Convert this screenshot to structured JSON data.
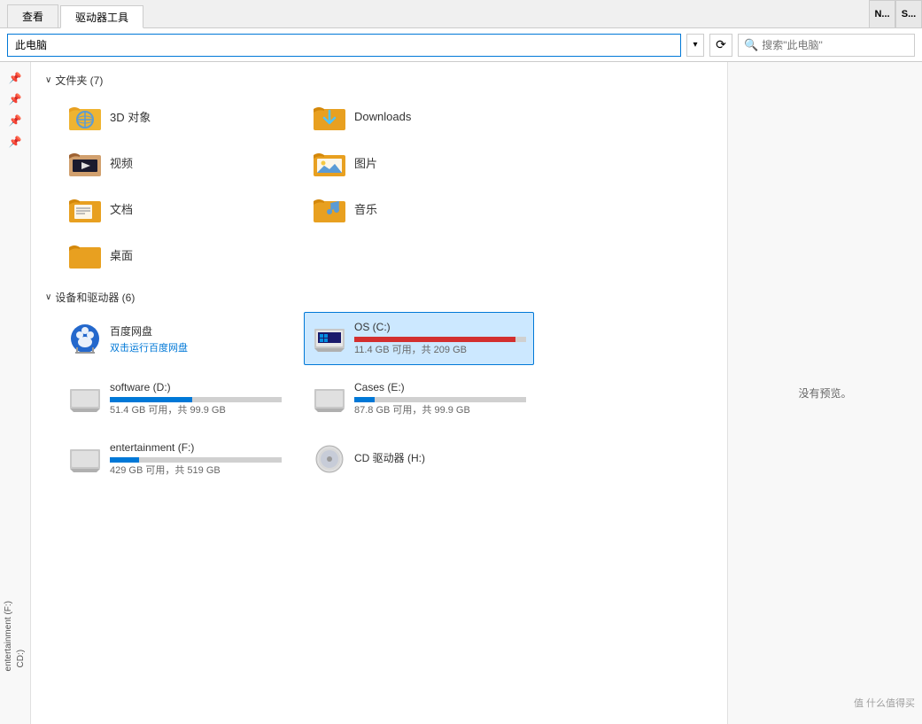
{
  "tabs": [
    {
      "id": "view",
      "label": "查看",
      "active": false
    },
    {
      "id": "driver",
      "label": "驱动器工具",
      "active": true
    }
  ],
  "tab_end_buttons": [
    {
      "id": "n",
      "label": "N..."
    },
    {
      "id": "s",
      "label": "S..."
    }
  ],
  "address_bar": {
    "path": "此电脑",
    "dropdown_char": "▾",
    "refresh_char": "⟳",
    "search_placeholder": "搜索\"此电脑\""
  },
  "folders_section": {
    "header": "文件夹 (7)",
    "arrow": "∨",
    "items": [
      {
        "id": "3d",
        "name": "3D 对象",
        "icon": "3d"
      },
      {
        "id": "downloads",
        "name": "Downloads",
        "icon": "downloads"
      },
      {
        "id": "videos",
        "name": "视频",
        "icon": "video"
      },
      {
        "id": "pictures",
        "name": "图片",
        "icon": "picture"
      },
      {
        "id": "documents",
        "name": "文档",
        "icon": "document"
      },
      {
        "id": "music",
        "name": "音乐",
        "icon": "music"
      },
      {
        "id": "desktop",
        "name": "桌面",
        "icon": "desktop"
      }
    ]
  },
  "devices_section": {
    "header": "设备和驱动器 (6)",
    "arrow": "∨",
    "items": [
      {
        "id": "baidu",
        "name": "百度网盘",
        "sub": "双击运行百度网盘",
        "type": "baidu",
        "progress": null,
        "progress_color": null
      },
      {
        "id": "os_c",
        "name": "OS (C:)",
        "sub": "11.4 GB 可用，共 209 GB",
        "type": "drive",
        "progress": 94,
        "progress_color": "red",
        "selected": true
      },
      {
        "id": "software_d",
        "name": "software (D:)",
        "sub": "51.4 GB 可用，共 99.9 GB",
        "type": "drive",
        "progress": 48,
        "progress_color": "blue",
        "selected": false
      },
      {
        "id": "cases_e",
        "name": "Cases (E:)",
        "sub": "87.8 GB 可用，共 99.9 GB",
        "type": "drive",
        "progress": 12,
        "progress_color": "blue",
        "selected": false
      },
      {
        "id": "entertainment_f",
        "name": "entertainment (F:)",
        "sub": "429 GB 可用，共 519 GB",
        "type": "drive",
        "progress": 17,
        "progress_color": "blue",
        "selected": false
      },
      {
        "id": "cd_h",
        "name": "CD 驱动器 (H:)",
        "sub": "",
        "type": "cd",
        "progress": null,
        "progress_color": null,
        "selected": false
      }
    ]
  },
  "preview_panel": {
    "no_preview_text": "没有预览。"
  },
  "watermark": "值 什么值得买",
  "sidebar": {
    "pins": [
      "📌",
      "📌",
      "📌",
      "📌"
    ]
  },
  "left_sidebar_labels": [
    {
      "id": "entertainment-f",
      "label": "entertainment (F:)"
    },
    {
      "id": "cd-h",
      "label": "CD:)"
    }
  ]
}
